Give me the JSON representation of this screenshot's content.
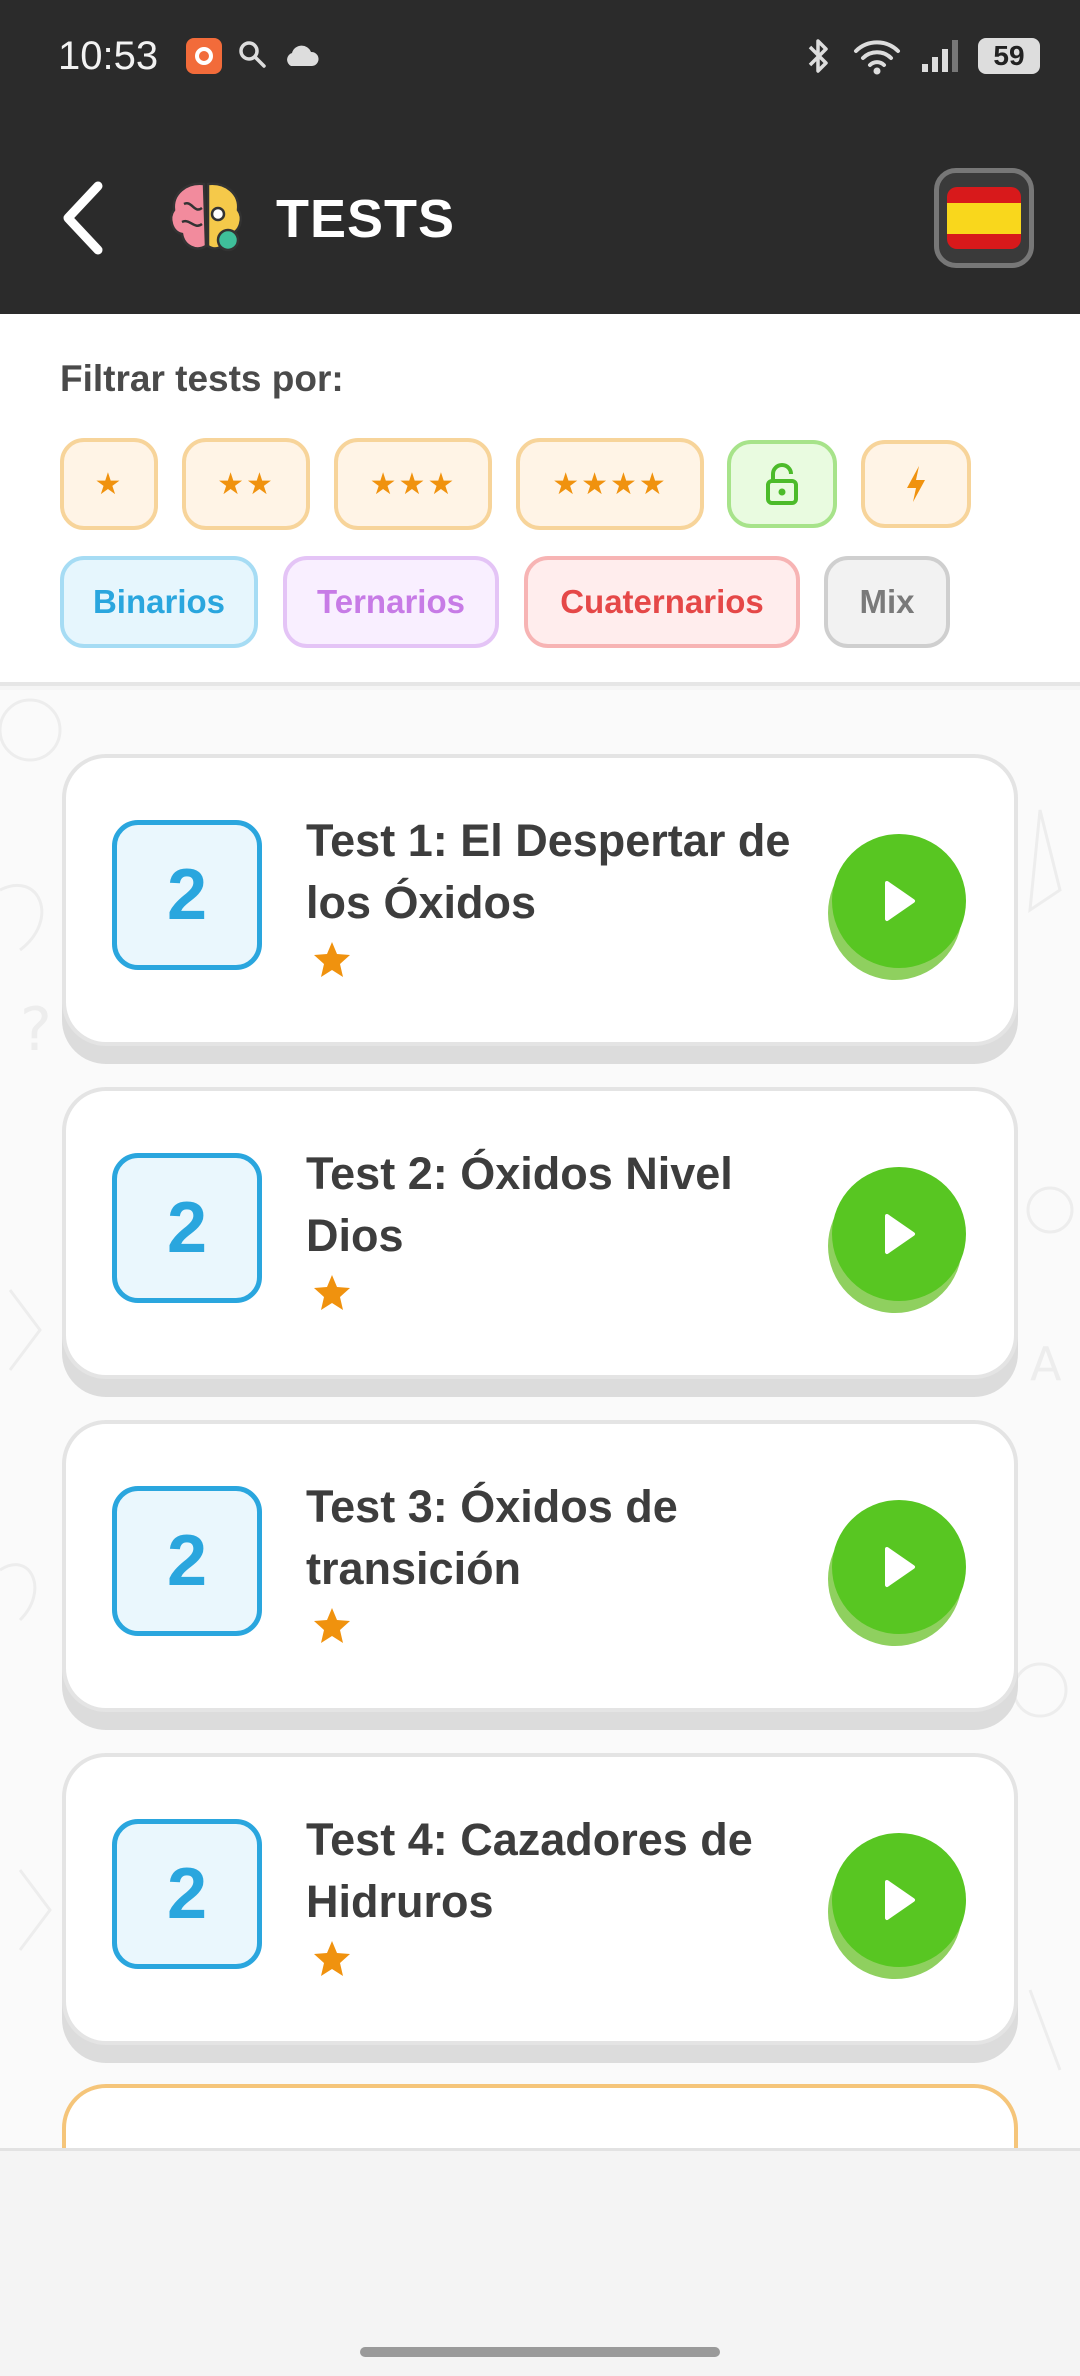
{
  "status_bar": {
    "time": "10:53",
    "battery": "59",
    "icons": [
      "app-notification-icon",
      "search-icon",
      "cloud-icon",
      "bluetooth-icon",
      "wifi-icon",
      "signal-icon",
      "battery-icon"
    ]
  },
  "header": {
    "title": "TESTS",
    "back_icon": "back-chevron-icon",
    "logo_icon": "brain-logo-icon",
    "language_flag": "spain-flag-icon"
  },
  "filters": {
    "label": "Filtrar tests por:",
    "difficulty_chips": [
      "★",
      "★★",
      "★★★",
      "★★★★"
    ],
    "lock_icon": "lock-icon",
    "bolt_icon": "lightning-icon",
    "type_chips": {
      "binarios": "Binarios",
      "ternarios": "Ternarios",
      "cuaternarios": "Cuaternarios",
      "mix": "Mix"
    }
  },
  "tests": [
    {
      "level": "2",
      "name": "Test 1: El Despertar de los Óxidos",
      "stars": 1
    },
    {
      "level": "2",
      "name": "Test 2: Óxidos Nivel Dios",
      "stars": 1
    },
    {
      "level": "2",
      "name": "Test 3: Óxidos de transición",
      "stars": 1
    },
    {
      "level": "2",
      "name": "Test 4: Cazadores de Hidruros",
      "stars": 1
    }
  ],
  "colors": {
    "header_bg": "#2b2b2b",
    "accent_blue": "#2aa6de",
    "play_green": "#58c622",
    "star_orange": "#f0920e"
  }
}
